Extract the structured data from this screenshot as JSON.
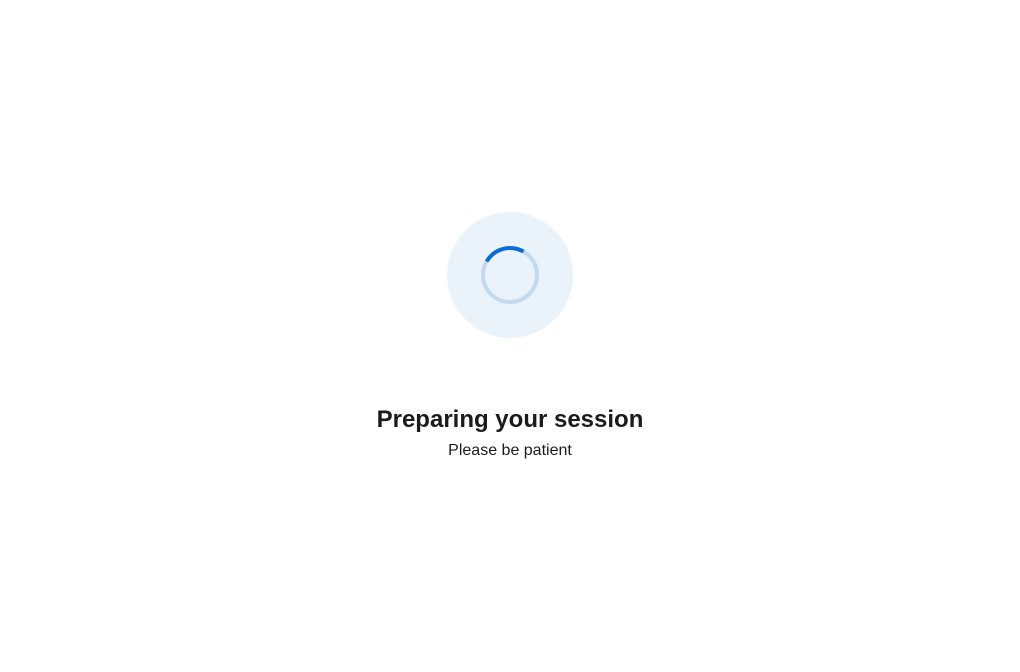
{
  "loading": {
    "heading": "Preparing your session",
    "subtext": "Please be patient"
  }
}
